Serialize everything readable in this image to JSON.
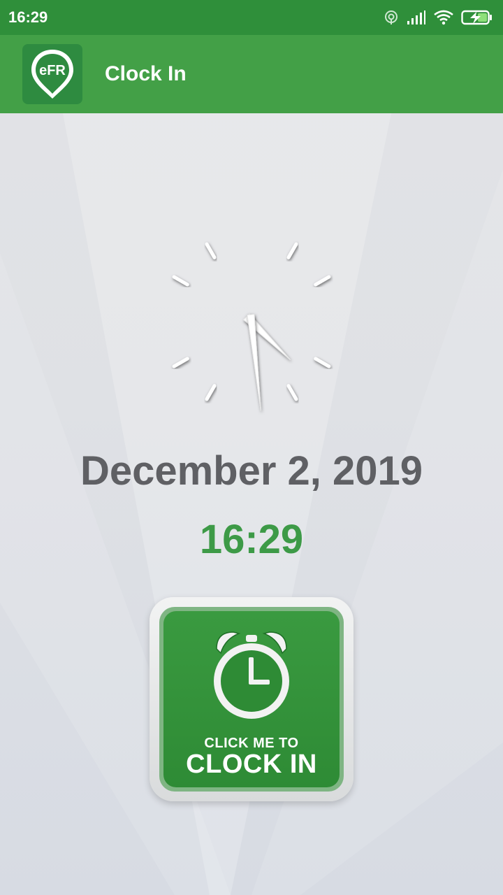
{
  "status_bar": {
    "time": "16:29",
    "icons": [
      "hotspot-icon",
      "signal-icon",
      "wifi-icon",
      "battery-charging-icon"
    ]
  },
  "app_bar": {
    "title": "Clock In",
    "logo_text": "eFR"
  },
  "clock": {
    "hours": 16,
    "minutes": 29
  },
  "date": "December 2, 2019",
  "digital_time": "16:29",
  "clock_in_button": {
    "line1": "CLICK ME TO",
    "line2": "CLOCK IN"
  },
  "colors": {
    "status_bar": "#2f8f3a",
    "app_bar": "#43a047",
    "accent_green": "#3d9a47",
    "date_text": "#5f6064"
  }
}
